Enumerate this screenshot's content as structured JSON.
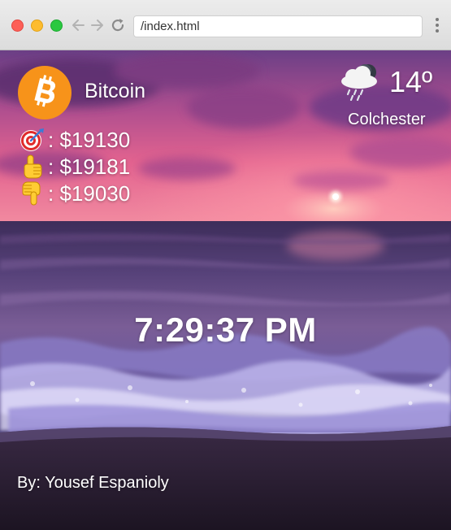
{
  "browser": {
    "url": "/index.html"
  },
  "coin": {
    "name": "Bitcoin",
    "symbol": "₿",
    "color": "#f7931a"
  },
  "prices": [
    {
      "icon": "target-icon",
      "text": ": $19130"
    },
    {
      "icon": "pointing-up-icon",
      "text": ": $19181"
    },
    {
      "icon": "pointing-down-icon",
      "text": ": $19030"
    }
  ],
  "weather": {
    "icon": "rain-cloud-night-icon",
    "temperature": "14º",
    "city": "Colchester"
  },
  "clock": {
    "time": "7:29:37 PM"
  },
  "footer": {
    "author": "By: Yousef Espanioly"
  }
}
